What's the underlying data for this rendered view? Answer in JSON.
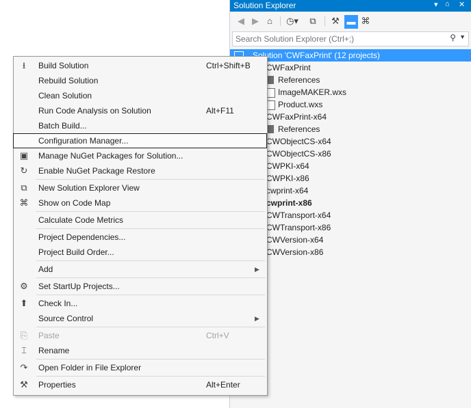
{
  "solution_explorer": {
    "title": "Solution Explorer",
    "pin_glyph": "▾",
    "pin2_glyph": "⌂",
    "close_glyph": "✕",
    "search_placeholder": "Search Solution Explorer (Ctrl+;)",
    "toolbar_icons": [
      "back-icon",
      "forward-icon",
      "home-icon",
      "history-icon",
      "collapse-icon",
      "properties-icon",
      "preview-icon",
      "class-view-icon"
    ],
    "tree": [
      {
        "label": "Solution 'CWFaxPrint' (12 projects)",
        "selected": true,
        "bold": false,
        "icon": "solution-icon"
      },
      {
        "label": "CWFaxPrint",
        "selected": false,
        "bold": false,
        "icon": ""
      },
      {
        "label": "References",
        "selected": false,
        "bold": false,
        "icon": "references-icon"
      },
      {
        "label": "ImageMAKER.wxs",
        "selected": false,
        "bold": false,
        "icon": "file-icon"
      },
      {
        "label": "Product.wxs",
        "selected": false,
        "bold": false,
        "icon": "file-icon"
      },
      {
        "label": "CWFaxPrint-x64",
        "selected": false,
        "bold": false,
        "icon": ""
      },
      {
        "label": "References",
        "selected": false,
        "bold": false,
        "icon": "references-icon"
      },
      {
        "label": "CWObjectCS-x64",
        "selected": false,
        "bold": false,
        "icon": ""
      },
      {
        "label": "CWObjectCS-x86",
        "selected": false,
        "bold": false,
        "icon": ""
      },
      {
        "label": "CWPKI-x64",
        "selected": false,
        "bold": false,
        "icon": ""
      },
      {
        "label": "CWPKI-x86",
        "selected": false,
        "bold": false,
        "icon": ""
      },
      {
        "label": "cwprint-x64",
        "selected": false,
        "bold": false,
        "icon": ""
      },
      {
        "label": "cwprint-x86",
        "selected": false,
        "bold": true,
        "icon": ""
      },
      {
        "label": "CWTransport-x64",
        "selected": false,
        "bold": false,
        "icon": ""
      },
      {
        "label": "CWTransport-x86",
        "selected": false,
        "bold": false,
        "icon": ""
      },
      {
        "label": "CWVersion-x64",
        "selected": false,
        "bold": false,
        "icon": ""
      },
      {
        "label": "CWVersion-x86",
        "selected": false,
        "bold": false,
        "icon": ""
      }
    ]
  },
  "context_menu": {
    "items": [
      {
        "label": "Build Solution",
        "shortcut": "Ctrl+Shift+B",
        "icon": "build-icon",
        "icon_glyph": "⭳",
        "disabled": false,
        "highlight": false,
        "submenu": false
      },
      {
        "label": "Rebuild Solution",
        "shortcut": "",
        "icon": "",
        "icon_glyph": "",
        "disabled": false,
        "highlight": false,
        "submenu": false
      },
      {
        "label": "Clean Solution",
        "shortcut": "",
        "icon": "",
        "icon_glyph": "",
        "disabled": false,
        "highlight": false,
        "submenu": false
      },
      {
        "label": "Run Code Analysis on Solution",
        "shortcut": "Alt+F11",
        "icon": "",
        "icon_glyph": "",
        "disabled": false,
        "highlight": false,
        "submenu": false
      },
      {
        "label": "Batch Build...",
        "shortcut": "",
        "icon": "",
        "icon_glyph": "",
        "disabled": false,
        "highlight": false,
        "submenu": false
      },
      {
        "label": "Configuration Manager...",
        "shortcut": "",
        "icon": "",
        "icon_glyph": "",
        "disabled": false,
        "highlight": true,
        "submenu": false
      },
      {
        "label": "Manage NuGet Packages for Solution...",
        "shortcut": "",
        "icon": "nuget-package-icon",
        "icon_glyph": "▣",
        "disabled": false,
        "highlight": false,
        "submenu": false
      },
      {
        "label": "Enable NuGet Package Restore",
        "shortcut": "",
        "icon": "package-restore-icon",
        "icon_glyph": "↻",
        "disabled": false,
        "highlight": false,
        "submenu": false
      },
      {
        "label": "New Solution Explorer View",
        "shortcut": "",
        "icon": "new-view-icon",
        "icon_glyph": "⧉",
        "disabled": false,
        "highlight": false,
        "submenu": false
      },
      {
        "label": "Show on Code Map",
        "shortcut": "",
        "icon": "code-map-icon",
        "icon_glyph": "⌘",
        "disabled": false,
        "highlight": false,
        "submenu": false
      },
      {
        "label": "Calculate Code Metrics",
        "shortcut": "",
        "icon": "",
        "icon_glyph": "",
        "disabled": false,
        "highlight": false,
        "submenu": false
      },
      {
        "label": "Project Dependencies...",
        "shortcut": "",
        "icon": "",
        "icon_glyph": "",
        "disabled": false,
        "highlight": false,
        "submenu": false
      },
      {
        "label": "Project Build Order...",
        "shortcut": "",
        "icon": "",
        "icon_glyph": "",
        "disabled": false,
        "highlight": false,
        "submenu": false
      },
      {
        "label": "Add",
        "shortcut": "",
        "icon": "",
        "icon_glyph": "",
        "disabled": false,
        "highlight": false,
        "submenu": true
      },
      {
        "label": "Set StartUp Projects...",
        "shortcut": "",
        "icon": "settings-gear-icon",
        "icon_glyph": "⚙",
        "disabled": false,
        "highlight": false,
        "submenu": false
      },
      {
        "label": "Check In...",
        "shortcut": "",
        "icon": "check-in-icon",
        "icon_glyph": "⬆",
        "disabled": false,
        "highlight": false,
        "submenu": false
      },
      {
        "label": "Source Control",
        "shortcut": "",
        "icon": "",
        "icon_glyph": "",
        "disabled": false,
        "highlight": false,
        "submenu": true
      },
      {
        "label": "Paste",
        "shortcut": "Ctrl+V",
        "icon": "paste-icon",
        "icon_glyph": "⎘",
        "disabled": true,
        "highlight": false,
        "submenu": false
      },
      {
        "label": "Rename",
        "shortcut": "",
        "icon": "rename-icon",
        "icon_glyph": "⌶",
        "disabled": false,
        "highlight": false,
        "submenu": false
      },
      {
        "label": "Open Folder in File Explorer",
        "shortcut": "",
        "icon": "open-folder-icon",
        "icon_glyph": "↷",
        "disabled": false,
        "highlight": false,
        "submenu": false
      },
      {
        "label": "Properties",
        "shortcut": "Alt+Enter",
        "icon": "wrench-icon",
        "icon_glyph": "⚒",
        "disabled": false,
        "highlight": false,
        "submenu": false
      }
    ]
  }
}
